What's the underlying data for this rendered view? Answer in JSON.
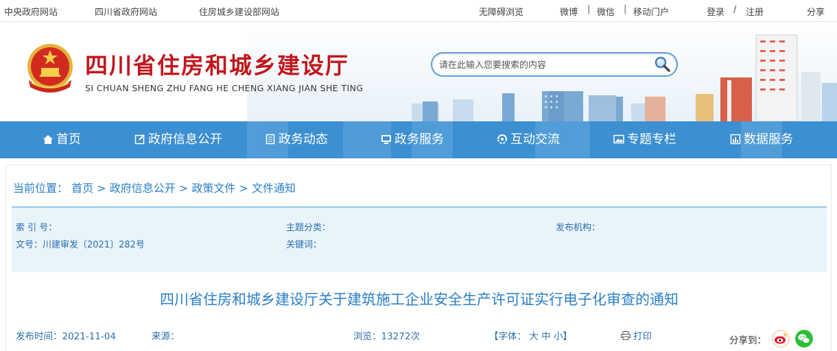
{
  "topbar": {
    "links": [
      "中央政府网站",
      "四川省政府网站",
      "住房城乡建设部网站"
    ],
    "accessible": "无障碍浏览",
    "weibo": "微博",
    "wechat": "微信",
    "mobile": "移动门户",
    "sep": "|",
    "login": "登录",
    "slash": "/",
    "register": "注册",
    "share": "分享"
  },
  "header": {
    "title": "四川省住房和城乡建设厅",
    "subtitle": "SI CHUAN SHENG ZHU FANG HE CHENG XIANG JIAN SHE TING",
    "search_placeholder": "请在此输入您要搜索的内容"
  },
  "nav": [
    {
      "label": "首页",
      "icon": "home-icon"
    },
    {
      "label": "政府信息公开",
      "icon": "edit-icon"
    },
    {
      "label": "政务动态",
      "icon": "document-icon"
    },
    {
      "label": "政务服务",
      "icon": "monitor-icon"
    },
    {
      "label": "互动交流",
      "icon": "interaction-icon"
    },
    {
      "label": "专题专栏",
      "icon": "image-icon"
    },
    {
      "label": "数据服务",
      "icon": "chart-icon"
    }
  ],
  "breadcrumb": {
    "label": "当前位置：",
    "items": [
      "首页",
      "政府信息公开",
      "政策文件",
      "文件通知"
    ],
    "sep": ">"
  },
  "meta": {
    "index_label": "索 引 号：",
    "topic_label": "主题分类：",
    "publisher_label": "发布机构：",
    "docno": "文号：川建审发〔2021〕282号",
    "keywords_label": "关键词："
  },
  "article": {
    "title": "四川省住房和城乡建设厅关于建筑施工企业安全生产许可证实行电子化审查的通知",
    "date": "发布时间：2021-11-04",
    "source": "来源：",
    "views": "浏览：13272次",
    "font_size": "【字体： 大 中 小】",
    "print": "打印",
    "share_to": "分享到："
  },
  "colors": {
    "accent": "#3c8fd0",
    "title_red": "#c1161c",
    "link_blue": "#2a7fc7"
  }
}
